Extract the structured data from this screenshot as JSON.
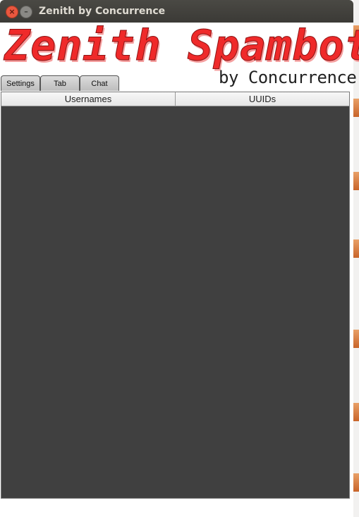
{
  "window": {
    "title": "Zenith by Concurrence"
  },
  "banner": {
    "title": "Zenith Spambot",
    "subtitle": "by Concurrence"
  },
  "tabs": [
    {
      "label": "Settings"
    },
    {
      "label": "Tab"
    },
    {
      "label": "Chat"
    }
  ],
  "table": {
    "columns": [
      "Usernames",
      "UUIDs"
    ],
    "rows": []
  },
  "colors": {
    "titlebar": "#3b3a36",
    "banner_red": "#ef2a2a",
    "table_body": "#404040"
  },
  "icons": {
    "close": "close-icon",
    "minimize": "minimize-icon"
  }
}
